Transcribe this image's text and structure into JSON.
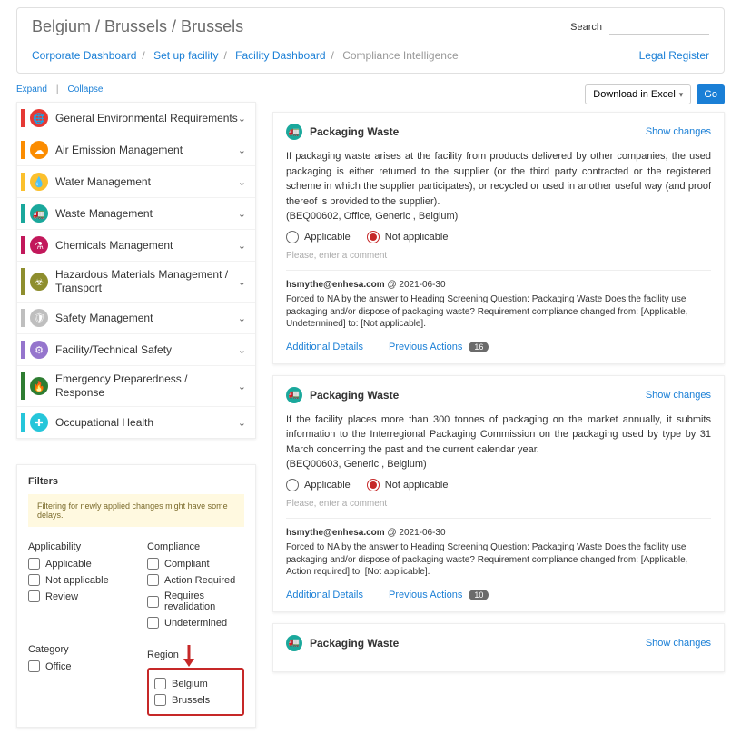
{
  "header": {
    "title": "Belgium / Brussels / Brussels",
    "search_label": "Search",
    "legal_register": "Legal Register",
    "crumbs": [
      "Corporate Dashboard",
      "Set up facility",
      "Facility Dashboard"
    ],
    "crumb_current": "Compliance Intelligence"
  },
  "controls": {
    "expand": "Expand",
    "collapse": "Collapse",
    "download": "Download in Excel",
    "go": "Go"
  },
  "categories": [
    {
      "label": "General Environmental Requirements",
      "color": "#e53935",
      "icon": "🌐"
    },
    {
      "label": "Air Emission Management",
      "color": "#fb8c00",
      "icon": "☁"
    },
    {
      "label": "Water Management",
      "color": "#fbc02d",
      "icon": "💧"
    },
    {
      "label": "Waste Management",
      "color": "#1aa89c",
      "icon": "🚛"
    },
    {
      "label": "Chemicals Management",
      "color": "#c2185b",
      "icon": "⚗"
    },
    {
      "label": "Hazardous Materials Management / Transport",
      "color": "#8e8e2e",
      "icon": "☣"
    },
    {
      "label": "Safety Management",
      "color": "#bfbfbf",
      "icon": "🛡"
    },
    {
      "label": "Facility/Technical Safety",
      "color": "#9575cd",
      "icon": "⚙"
    },
    {
      "label": "Emergency Preparedness / Response",
      "color": "#2e7d32",
      "icon": "🔥"
    },
    {
      "label": "Occupational Health",
      "color": "#26c6da",
      "icon": "✚"
    }
  ],
  "filters": {
    "title": "Filters",
    "note": "Filtering for newly applied changes might have some delays.",
    "applicability_h": "Applicability",
    "applicability": [
      "Applicable",
      "Not applicable",
      "Review"
    ],
    "compliance_h": "Compliance",
    "compliance": [
      "Compliant",
      "Action Required",
      "Requires revalidation",
      "Undetermined"
    ],
    "category_h": "Category",
    "category": [
      "Office"
    ],
    "region_h": "Region",
    "region": [
      "Belgium",
      "Brussels"
    ]
  },
  "labels": {
    "show_changes": "Show changes",
    "applicable": "Applicable",
    "not_applicable": "Not applicable",
    "comment_ph": "Please, enter a comment",
    "additional_details": "Additional Details",
    "previous_actions": "Previous Actions"
  },
  "requirements": [
    {
      "title": "Packaging Waste",
      "body": "If packaging waste arises at the facility from products delivered by other companies, the used packaging is either returned to the supplier (or the third party contracted or the registered scheme in which the supplier participates), or recycled or used in another useful way (and proof thereof is provided to the supplier).",
      "ref": "(BEQ00602, Office, Generic , Belgium)",
      "author": "hsmythe@enhesa.com",
      "date": "2021-06-30",
      "forced": "Forced to NA by the answer to Heading Screening Question: Packaging Waste Does the facility use packaging and/or dispose of packaging waste? Requirement compliance changed from: [Applicable, Undetermined] to: [Not applicable].",
      "prev_count": "16"
    },
    {
      "title": "Packaging Waste",
      "body": "If the facility places more than 300 tonnes of packaging on the market annually, it submits information to the Interregional Packaging Commission on the packaging used by type by 31 March concerning the past and the current calendar year.",
      "ref": "(BEQ00603, Generic , Belgium)",
      "author": "hsmythe@enhesa.com",
      "date": "2021-06-30",
      "forced": "Forced to NA by the answer to Heading Screening Question: Packaging Waste Does the facility use packaging and/or dispose of packaging waste? Requirement compliance changed from: [Applicable, Action required] to: [Not applicable].",
      "prev_count": "10"
    },
    {
      "title": "Packaging Waste",
      "body": "",
      "ref": "",
      "author": "",
      "date": "",
      "forced": "",
      "prev_count": ""
    }
  ]
}
